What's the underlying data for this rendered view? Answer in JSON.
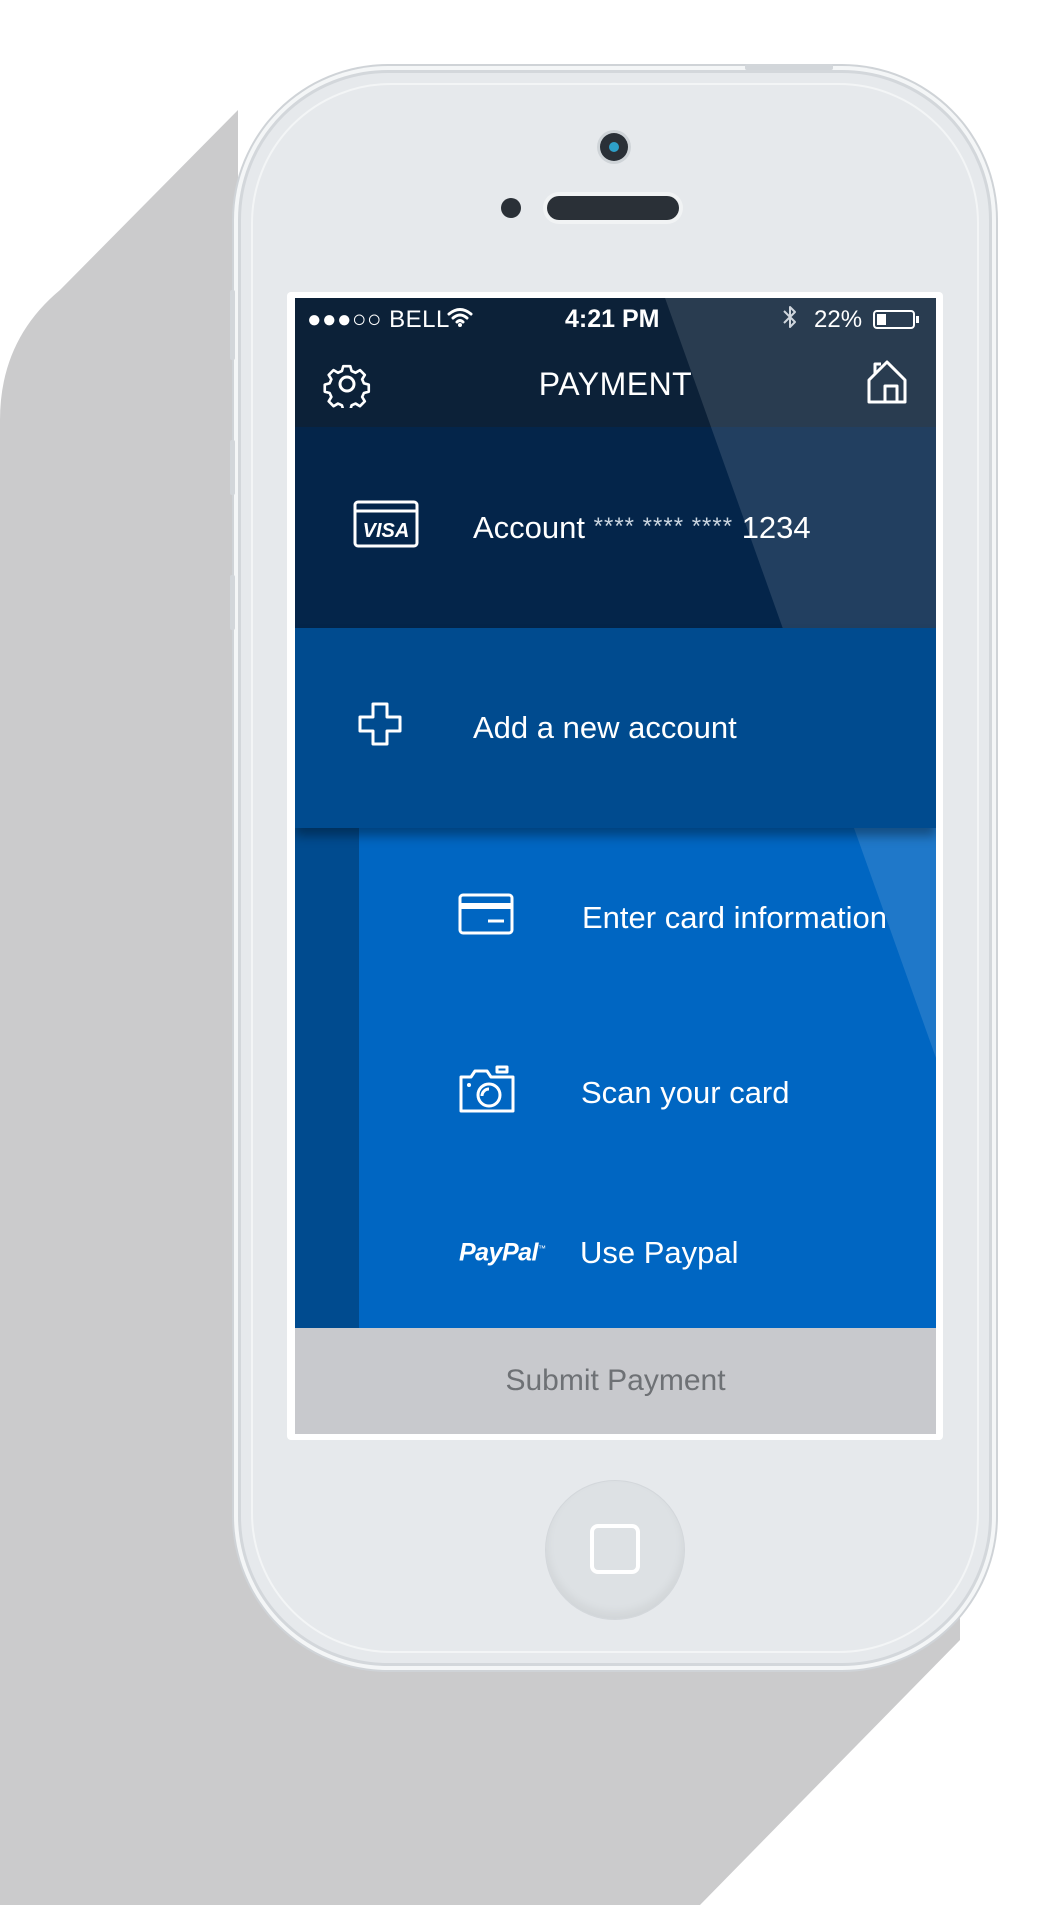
{
  "status_bar": {
    "signal": "●●●○○",
    "carrier": "BELL",
    "time": "4:21 PM",
    "battery_percent": "22%",
    "icons": [
      "wifi-icon",
      "bluetooth-icon",
      "battery-icon"
    ]
  },
  "nav": {
    "title": "PAYMENT",
    "left_icon": "gear-icon",
    "right_icon": "home-icon"
  },
  "account_row": {
    "prefix": "Account",
    "masked": "**** **** ****",
    "last4": "1234",
    "icon": "visa-card-icon",
    "icon_text": "VISA"
  },
  "add_account": {
    "label": "Add a new account",
    "icon": "plus-icon"
  },
  "options": [
    {
      "label": "Enter card information",
      "icon": "credit-card-icon"
    },
    {
      "label": "Scan your card",
      "icon": "camera-icon"
    },
    {
      "label": "Use Paypal",
      "icon": "paypal-logo",
      "icon_text": "PayPal"
    }
  ],
  "submit": {
    "label": "Submit Payment"
  },
  "colors": {
    "nav_bg": "#0c2138",
    "account_bg": "#04254a",
    "add_bg": "#004b8f",
    "options_bg": "#0066c2",
    "submit_bg": "#c8c9cd",
    "submit_text": "#6e7175"
  }
}
